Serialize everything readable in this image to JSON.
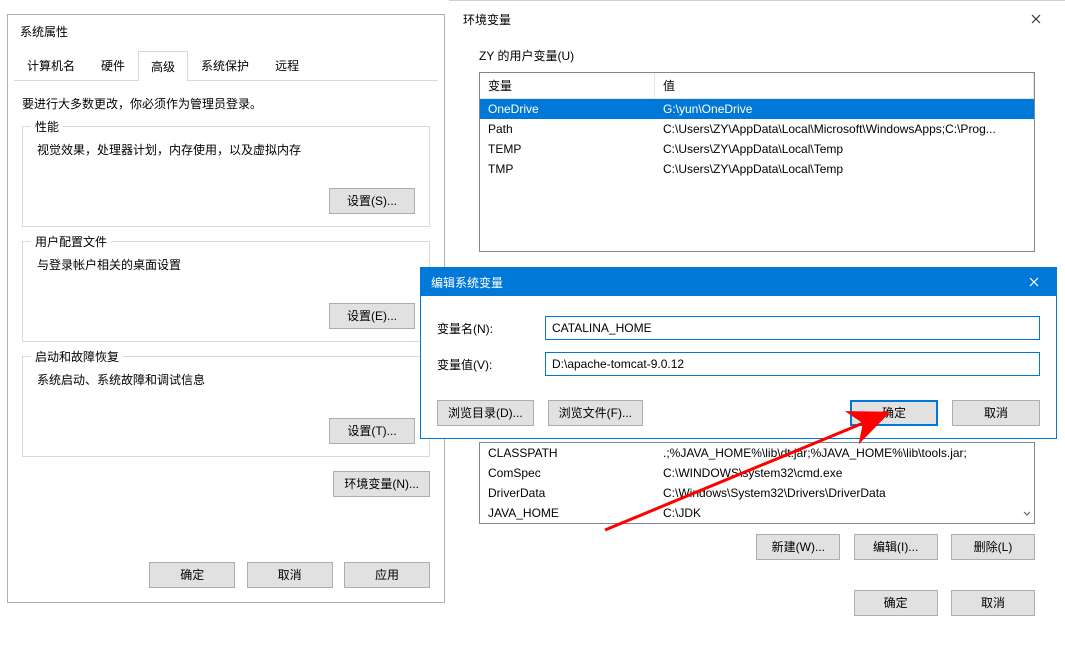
{
  "sysprop": {
    "title": "系统属性",
    "tabs": [
      "计算机名",
      "硬件",
      "高级",
      "系统保护",
      "远程"
    ],
    "active_tab": 2,
    "note": "要进行大多数更改，你必须作为管理员登录。",
    "groups": [
      {
        "title": "性能",
        "desc": "视觉效果，处理器计划，内存使用，以及虚拟内存",
        "btn": "设置(S)..."
      },
      {
        "title": "用户配置文件",
        "desc": "与登录帐户相关的桌面设置",
        "btn": "设置(E)..."
      },
      {
        "title": "启动和故障恢复",
        "desc": "系统启动、系统故障和调试信息",
        "btn": "设置(T)..."
      }
    ],
    "env_btn": "环境变量(N)...",
    "footer": {
      "ok": "确定",
      "cancel": "取消",
      "apply": "应用"
    }
  },
  "envwin": {
    "title": "环境变量",
    "user_section": "ZY 的用户变量(U)",
    "headers": {
      "var": "变量",
      "val": "值"
    },
    "user_vars": [
      {
        "name": "OneDrive",
        "value": "G:\\yun\\OneDrive"
      },
      {
        "name": "Path",
        "value": "C:\\Users\\ZY\\AppData\\Local\\Microsoft\\WindowsApps;C:\\Prog..."
      },
      {
        "name": "TEMP",
        "value": "C:\\Users\\ZY\\AppData\\Local\\Temp"
      },
      {
        "name": "TMP",
        "value": "C:\\Users\\ZY\\AppData\\Local\\Temp"
      }
    ],
    "sys_vars": [
      {
        "name": "CLASSPATH",
        "value": ".;%JAVA_HOME%\\lib\\dt.jar;%JAVA_HOME%\\lib\\tools.jar;"
      },
      {
        "name": "ComSpec",
        "value": "C:\\WINDOWS\\system32\\cmd.exe"
      },
      {
        "name": "DriverData",
        "value": "C:\\Windows\\System32\\Drivers\\DriverData"
      },
      {
        "name": "JAVA_HOME",
        "value": "C:\\JDK"
      }
    ],
    "btns": {
      "new": "新建(W)...",
      "edit": "编辑(I)...",
      "delete": "删除(L)"
    },
    "footer": {
      "ok": "确定",
      "cancel": "取消"
    }
  },
  "editdlg": {
    "title": "编辑系统变量",
    "name_label": "变量名(N):",
    "name_value": "CATALINA_HOME",
    "value_label": "变量值(V):",
    "value_value": "D:\\apache-tomcat-9.0.12",
    "browse_dir": "浏览目录(D)...",
    "browse_file": "浏览文件(F)...",
    "ok": "确定",
    "cancel": "取消"
  }
}
